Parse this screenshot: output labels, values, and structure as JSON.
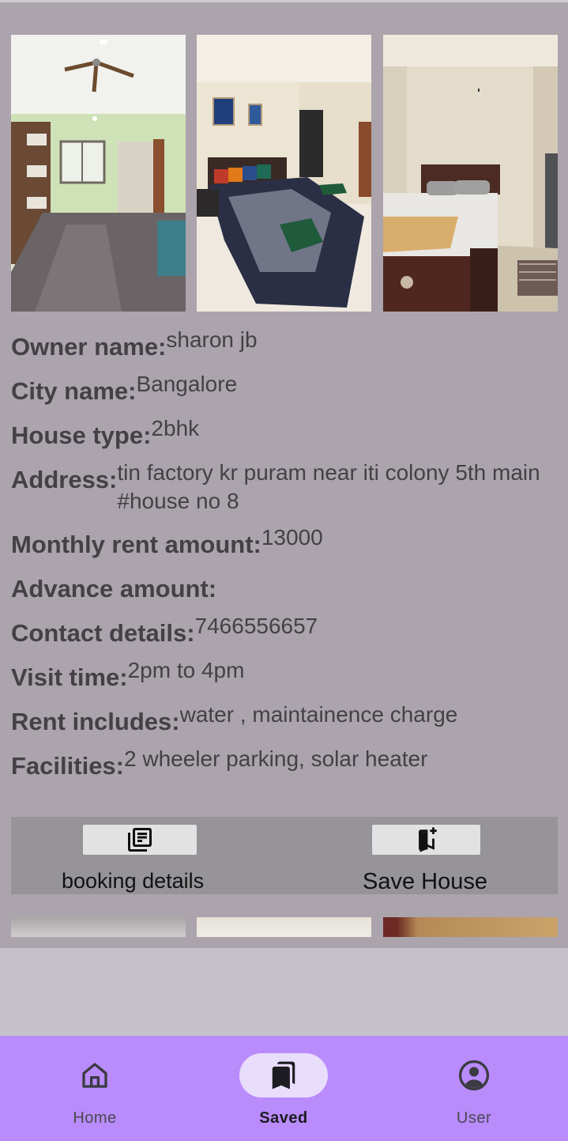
{
  "listing": {
    "fields": [
      {
        "label": "Owner name:",
        "value": "sharon jb"
      },
      {
        "label": "City name:",
        "value": "Bangalore"
      },
      {
        "label": "House type:",
        "value": "2bhk"
      },
      {
        "label": "Address:",
        "value": "tin factory kr puram near iti colony 5th main #house no 8"
      },
      {
        "label": "Monthly rent amount:",
        "value": "13000"
      },
      {
        "label": "Advance amount:",
        "value": ""
      },
      {
        "label": "Contact details:",
        "value": "7466556657"
      },
      {
        "label": "Visit time:",
        "value": "2pm to 4pm"
      },
      {
        "label": "Rent includes:",
        "value": "water , maintainence charge"
      },
      {
        "label": "Facilities:",
        "value": "2 wheeler parking, solar heater"
      }
    ]
  },
  "actions": {
    "booking_label": "booking details",
    "booking_icon": "library-books-icon",
    "save_label": "Save House",
    "save_icon": "bookmark-add-icon"
  },
  "bottom_nav": {
    "items": [
      {
        "label": "Home",
        "icon": "home-icon"
      },
      {
        "label": "Saved",
        "icon": "bookmarks-icon",
        "selected": true
      },
      {
        "label": "User",
        "icon": "account-circle-icon"
      }
    ]
  },
  "colors": {
    "card_background": "#aba4ac",
    "nav_background": "#b98bfb",
    "selected_pill": "#e9ddfc"
  }
}
